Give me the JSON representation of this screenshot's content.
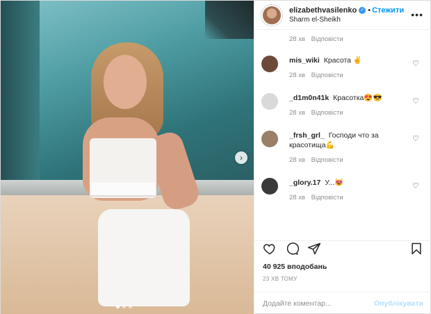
{
  "header": {
    "username": "elizabethvasilenko",
    "follow_label": "Стежити",
    "location": "Sharm el-Sheikh"
  },
  "first_meta": {
    "time": "28 хв",
    "reply": "Відповісти"
  },
  "comments": [
    {
      "user": "mis_wiki",
      "text": "Красота ✌",
      "time": "28 хв",
      "reply": "Відповісти",
      "avatar_color": "#6b4a3a"
    },
    {
      "user": "_d1m0n41k",
      "text": "Красотка😍😎",
      "time": "28 хв",
      "reply": "Відповісти",
      "avatar_color": "#d9d9d9"
    },
    {
      "user": "_frsh_grl_",
      "text": "Господи что за красотища💪",
      "time": "28 хв",
      "reply": "Відповісти",
      "avatar_color": "#9a8068"
    },
    {
      "user": "_glory.17",
      "text": "У...😻",
      "time": "28 хв",
      "reply": "Відповісти",
      "avatar_color": "#3a3a3a"
    }
  ],
  "likes": "40 925 вподобань",
  "timestamp": "23 ХВ ТОМУ",
  "add_comment": {
    "placeholder": "Додайте коментар...",
    "publish_label": "Опублікувати"
  },
  "colors": {
    "accent": "#0095f6",
    "publish_disabled": "#b2dffc",
    "muted": "#8e8e8e"
  }
}
